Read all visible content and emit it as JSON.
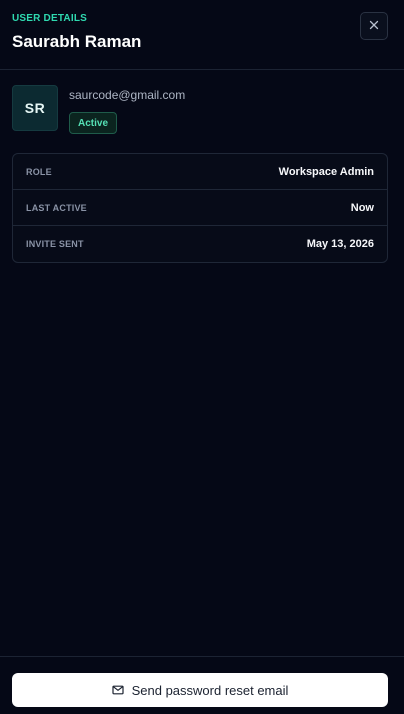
{
  "header": {
    "eyebrow": "USER DETAILS",
    "title": "Saurabh Raman",
    "close_icon": "close-icon"
  },
  "profile": {
    "initials": "SR",
    "email": "saurcode@gmail.com",
    "status": "Active"
  },
  "details": [
    {
      "label": "ROLE",
      "value": "Workspace Admin"
    },
    {
      "label": "LAST ACTIVE",
      "value": "Now"
    },
    {
      "label": "INVITE SENT",
      "value": "May 13, 2026"
    }
  ],
  "footer": {
    "reset_label": "Send password reset email",
    "reset_icon": "mail-icon"
  },
  "colors": {
    "background": "#050816",
    "accent": "#2fd9b0",
    "badge_text": "#55e0b5",
    "button_bg": "#ffffff"
  }
}
